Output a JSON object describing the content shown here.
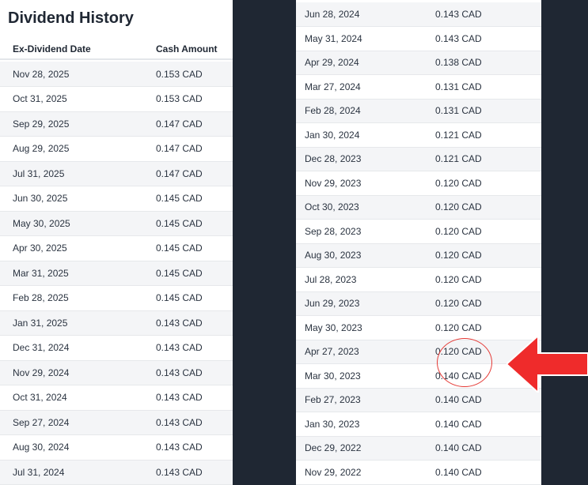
{
  "title": "Dividend History",
  "headers": {
    "date": "Ex-Dividend Date",
    "amount": "Cash Amount"
  },
  "accent_color": "#e53935",
  "left_rows": [
    {
      "date": "Nov 28, 2025",
      "amount": "0.153 CAD"
    },
    {
      "date": "Oct 31, 2025",
      "amount": "0.153 CAD"
    },
    {
      "date": "Sep 29, 2025",
      "amount": "0.147 CAD"
    },
    {
      "date": "Aug 29, 2025",
      "amount": "0.147 CAD"
    },
    {
      "date": "Jul 31, 2025",
      "amount": "0.147 CAD"
    },
    {
      "date": "Jun 30, 2025",
      "amount": "0.145 CAD"
    },
    {
      "date": "May 30, 2025",
      "amount": "0.145 CAD"
    },
    {
      "date": "Apr 30, 2025",
      "amount": "0.145 CAD"
    },
    {
      "date": "Mar 31, 2025",
      "amount": "0.145 CAD"
    },
    {
      "date": "Feb 28, 2025",
      "amount": "0.145 CAD"
    },
    {
      "date": "Jan 31, 2025",
      "amount": "0.143 CAD"
    },
    {
      "date": "Dec 31, 2024",
      "amount": "0.143 CAD"
    },
    {
      "date": "Nov 29, 2024",
      "amount": "0.143 CAD"
    },
    {
      "date": "Oct 31, 2024",
      "amount": "0.143 CAD"
    },
    {
      "date": "Sep 27, 2024",
      "amount": "0.143 CAD"
    },
    {
      "date": "Aug 30, 2024",
      "amount": "0.143 CAD"
    },
    {
      "date": "Jul 31, 2024",
      "amount": "0.143 CAD"
    }
  ],
  "right_rows": [
    {
      "date": "Jun 28, 2024",
      "amount": "0.143 CAD"
    },
    {
      "date": "May 31, 2024",
      "amount": "0.143 CAD"
    },
    {
      "date": "Apr 29, 2024",
      "amount": "0.138 CAD"
    },
    {
      "date": "Mar 27, 2024",
      "amount": "0.131 CAD"
    },
    {
      "date": "Feb 28, 2024",
      "amount": "0.131 CAD"
    },
    {
      "date": "Jan 30, 2024",
      "amount": "0.121 CAD"
    },
    {
      "date": "Dec 28, 2023",
      "amount": "0.121 CAD"
    },
    {
      "date": "Nov 29, 2023",
      "amount": "0.120 CAD"
    },
    {
      "date": "Oct 30, 2023",
      "amount": "0.120 CAD"
    },
    {
      "date": "Sep 28, 2023",
      "amount": "0.120 CAD"
    },
    {
      "date": "Aug 30, 2023",
      "amount": "0.120 CAD"
    },
    {
      "date": "Jul 28, 2023",
      "amount": "0.120 CAD"
    },
    {
      "date": "Jun 29, 2023",
      "amount": "0.120 CAD"
    },
    {
      "date": "May 30, 2023",
      "amount": "0.120 CAD"
    },
    {
      "date": "Apr 27, 2023",
      "amount": "0.120 CAD"
    },
    {
      "date": "Mar 30, 2023",
      "amount": "0.140 CAD"
    },
    {
      "date": "Feb 27, 2023",
      "amount": "0.140 CAD"
    },
    {
      "date": "Jan 30, 2023",
      "amount": "0.140 CAD"
    },
    {
      "date": "Dec 29, 2022",
      "amount": "0.140 CAD"
    },
    {
      "date": "Nov 29, 2022",
      "amount": "0.140 CAD"
    }
  ]
}
